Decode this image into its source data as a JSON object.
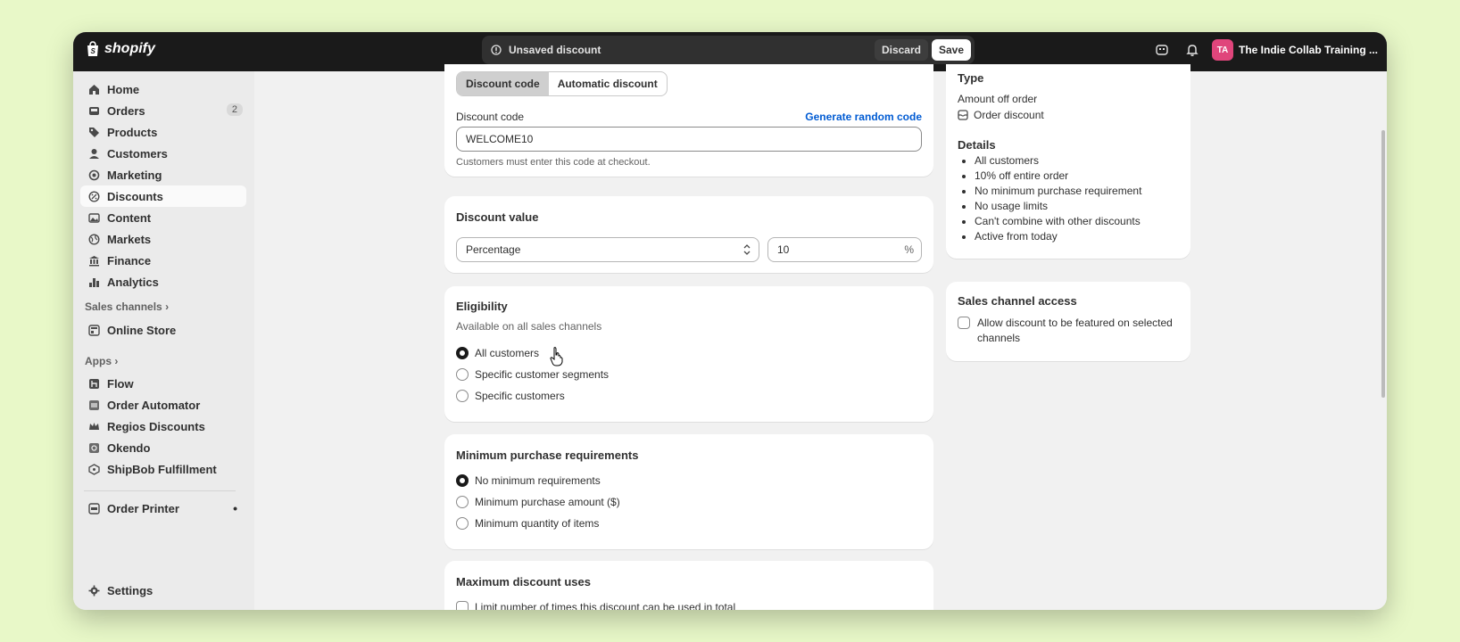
{
  "topbar": {
    "brand": "shopify",
    "savebar_message": "Unsaved discount",
    "discard_label": "Discard",
    "save_label": "Save",
    "avatar_initials": "TA",
    "store_name": "The Indie Collab Training ..."
  },
  "sidebar": {
    "items": [
      {
        "label": "Home",
        "icon": "home-icon"
      },
      {
        "label": "Orders",
        "icon": "inbox-icon",
        "badge": "2"
      },
      {
        "label": "Products",
        "icon": "tag-icon"
      },
      {
        "label": "Customers",
        "icon": "person-icon"
      },
      {
        "label": "Marketing",
        "icon": "target-icon"
      },
      {
        "label": "Discounts",
        "icon": "discount-icon",
        "active": true
      },
      {
        "label": "Content",
        "icon": "image-icon"
      },
      {
        "label": "Markets",
        "icon": "globe-icon"
      },
      {
        "label": "Finance",
        "icon": "bank-icon"
      },
      {
        "label": "Analytics",
        "icon": "bar-chart-icon"
      }
    ],
    "sales_channels_label": "Sales channels",
    "channels": [
      {
        "label": "Online Store",
        "icon": "store-icon"
      }
    ],
    "apps_label": "Apps",
    "apps": [
      {
        "label": "Flow",
        "icon": "flow-icon"
      },
      {
        "label": "Order Automator",
        "icon": "automator-icon"
      },
      {
        "label": "Regios Discounts",
        "icon": "crown-icon"
      },
      {
        "label": "Okendo",
        "icon": "okendo-icon"
      },
      {
        "label": "ShipBob Fulfillment",
        "icon": "shipbob-icon"
      }
    ],
    "order_printer": "Order Printer",
    "settings": "Settings"
  },
  "method_card": {
    "tabs": [
      "Discount code",
      "Automatic discount"
    ],
    "code_label": "Discount code",
    "generate_link": "Generate random code",
    "code_value": "WELCOME10",
    "help": "Customers must enter this code at checkout."
  },
  "value_card": {
    "title": "Discount value",
    "type_value": "Percentage",
    "amount_value": "10",
    "suffix": "%"
  },
  "eligibility_card": {
    "title": "Eligibility",
    "subtitle": "Available on all sales channels",
    "options": [
      "All customers",
      "Specific customer segments",
      "Specific customers"
    ],
    "selected": 0
  },
  "min_purchase_card": {
    "title": "Minimum purchase requirements",
    "options": [
      "No minimum requirements",
      "Minimum purchase amount ($)",
      "Minimum quantity of items"
    ],
    "selected": 0
  },
  "max_uses_card": {
    "title": "Maximum discount uses",
    "option": "Limit number of times this discount can be used in total"
  },
  "summary_card": {
    "type_label": "Type",
    "type_value": "Amount off order",
    "type_detail": "Order discount",
    "details_label": "Details",
    "details": [
      "All customers",
      "10% off entire order",
      "No minimum purchase requirement",
      "No usage limits",
      "Can't combine with other discounts",
      "Active from today"
    ]
  },
  "channel_card": {
    "title": "Sales channel access",
    "option": "Allow discount to be featured on selected channels"
  },
  "colors": {
    "accent_link": "#005bd3",
    "topbar": "#1a1a1a",
    "avatar": "#e0457b",
    "page_bg": "#e8f8c8"
  }
}
